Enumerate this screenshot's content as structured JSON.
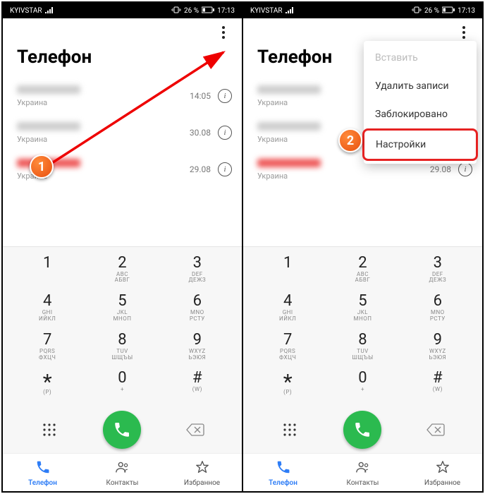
{
  "statusbar": {
    "carrier": "KYIVSTAR",
    "battery": "26 %",
    "time": "17:13"
  },
  "page_title": "Телефон",
  "calls": [
    {
      "sub": "Украина",
      "time": "14:05",
      "red": false
    },
    {
      "sub": "Украина",
      "time": "30.08",
      "red": false
    },
    {
      "sub": "Украина",
      "time": "29.08",
      "red": true
    }
  ],
  "keys": [
    {
      "d": "1",
      "l1": "",
      "l2": ""
    },
    {
      "d": "2",
      "l1": "ABC",
      "l2": "АБВГ"
    },
    {
      "d": "3",
      "l1": "DEF",
      "l2": "ДЕЖЗ"
    },
    {
      "d": "4",
      "l1": "GHI",
      "l2": "ИЙКЛ"
    },
    {
      "d": "5",
      "l1": "JKL",
      "l2": "МНОП"
    },
    {
      "d": "6",
      "l1": "MNO",
      "l2": "РСТУ"
    },
    {
      "d": "7",
      "l1": "PQRS",
      "l2": "ФХЦЧ"
    },
    {
      "d": "8",
      "l1": "TUV",
      "l2": "ШЩЪЫ"
    },
    {
      "d": "9",
      "l1": "WXYZ",
      "l2": "ЬЭЮЯ"
    },
    {
      "d": "*",
      "l1": "(P)",
      "l2": ""
    },
    {
      "d": "0",
      "l1": "+",
      "l2": ""
    },
    {
      "d": "#",
      "l1": "(W)",
      "l2": ""
    }
  ],
  "tabs": {
    "phone": "Телефон",
    "contacts": "Контакты",
    "favorites": "Избранное"
  },
  "popup": {
    "paste": "Вставить",
    "delete": "Удалить записи",
    "blocked": "Заблокировано",
    "settings": "Настройки"
  },
  "markers": {
    "one": "1",
    "two": "2"
  }
}
